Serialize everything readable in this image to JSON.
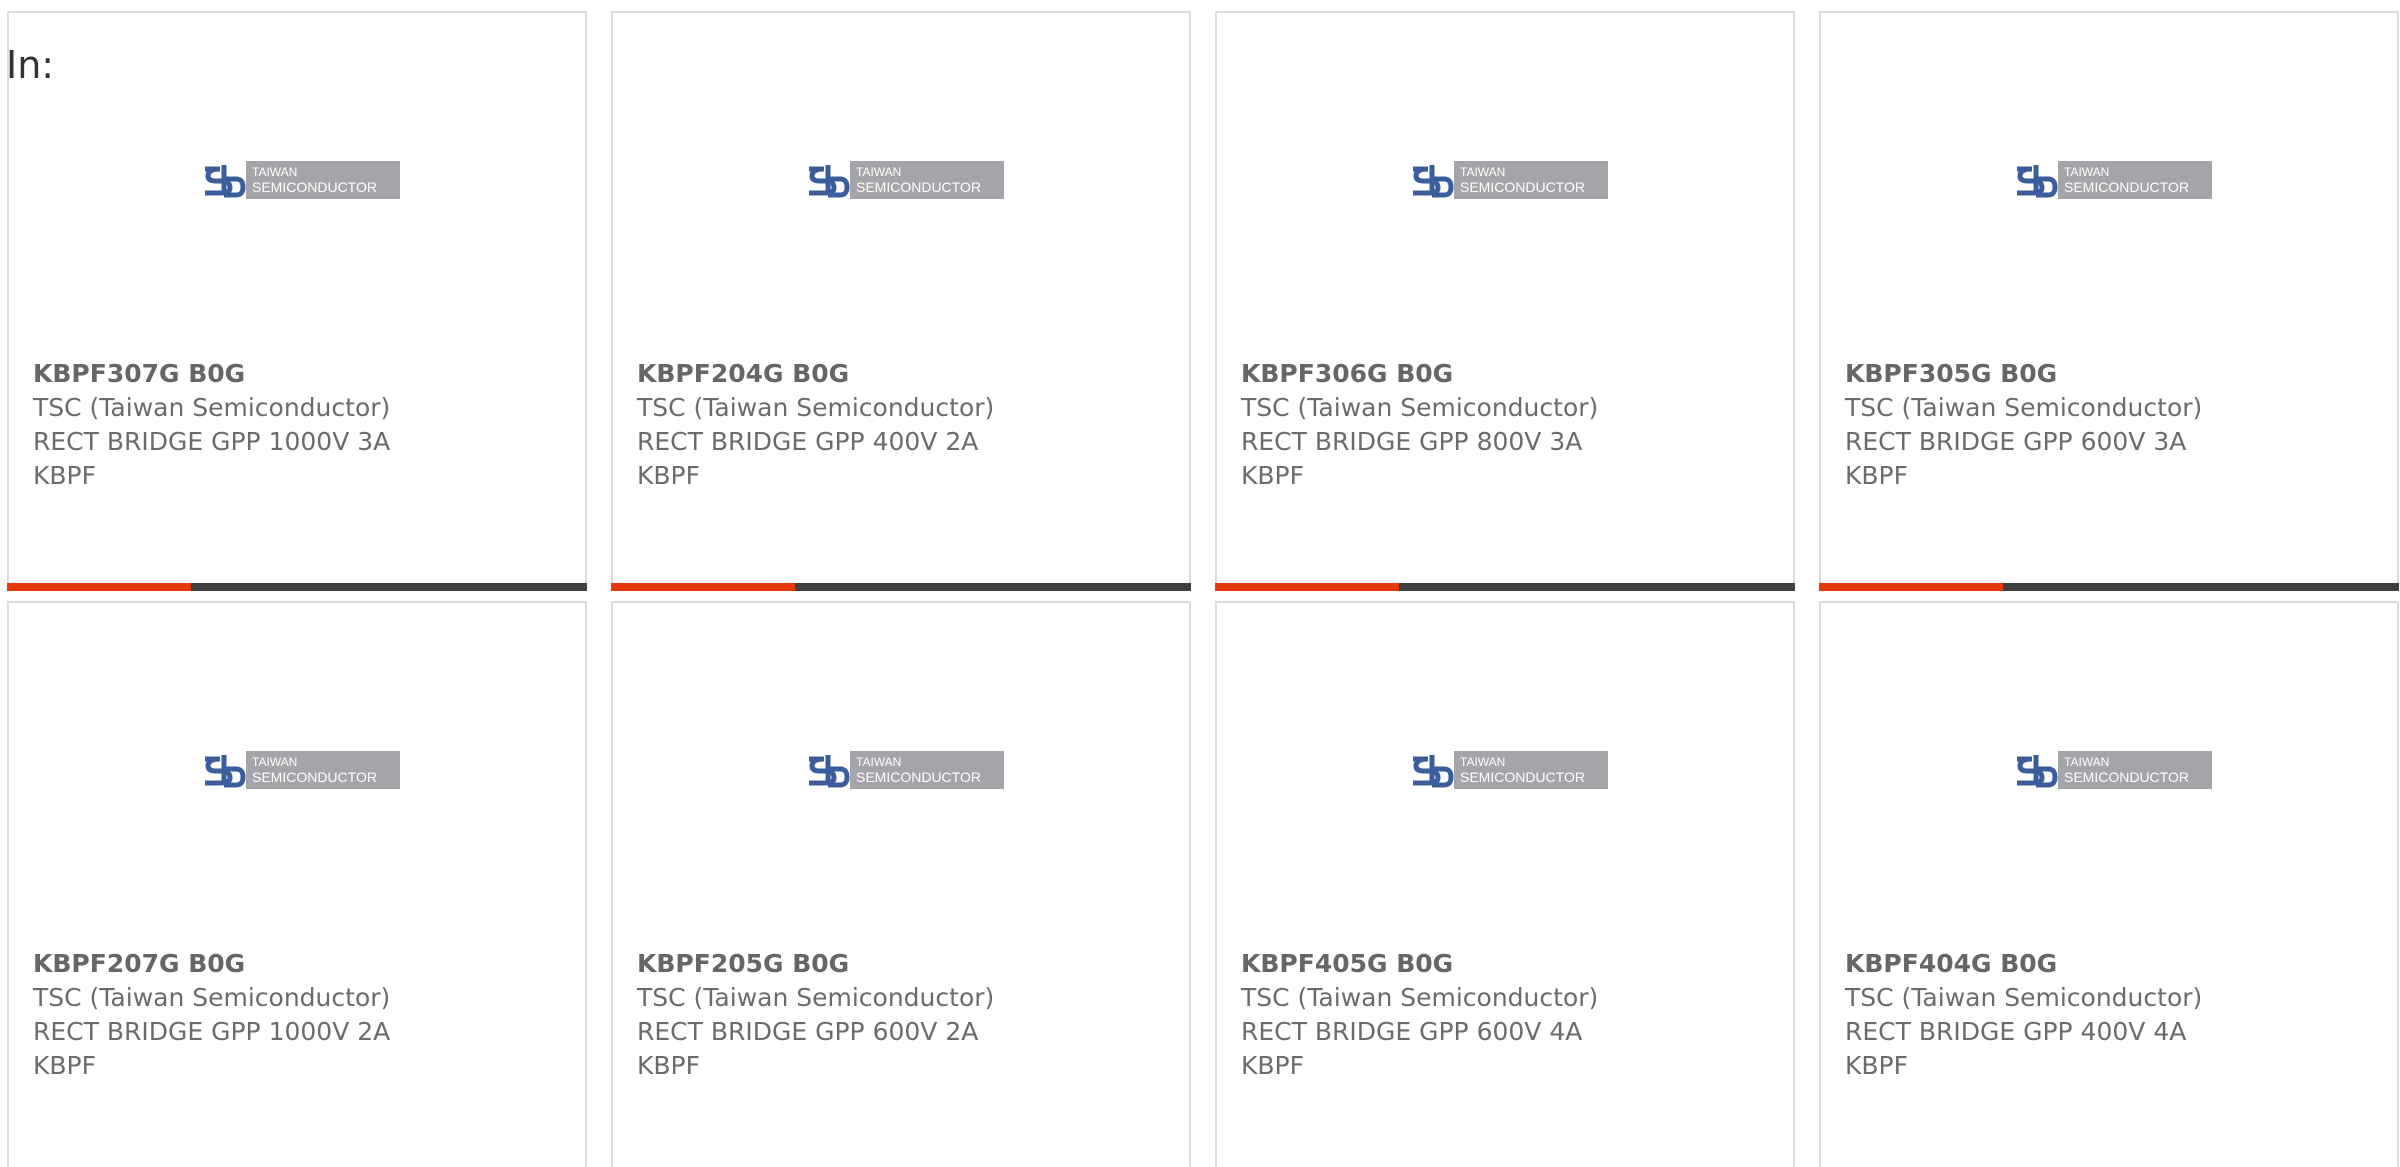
{
  "filter": {
    "label": "In:"
  },
  "colors": {
    "accent": "#e8380d",
    "bar": "#3f3f3f"
  },
  "logo": {
    "icon": "taiwan-semiconductor-logo",
    "line1": "TAIWAN",
    "line2": "SEMICONDUCTOR"
  },
  "products": [
    {
      "part": "KBPF307G B0G",
      "maker": "TSC (Taiwan Semiconductor)",
      "desc_line1": "RECT BRIDGE GPP 1000V 3A",
      "desc_line2": "KBPF"
    },
    {
      "part": "KBPF204G B0G",
      "maker": "TSC (Taiwan Semiconductor)",
      "desc_line1": "RECT BRIDGE GPP 400V 2A KBPF",
      "desc_line2": ""
    },
    {
      "part": "KBPF306G B0G",
      "maker": "TSC (Taiwan Semiconductor)",
      "desc_line1": "RECT BRIDGE GPP 800V 3A KBPF",
      "desc_line2": ""
    },
    {
      "part": "KBPF305G B0G",
      "maker": "TSC (Taiwan Semiconductor)",
      "desc_line1": "RECT BRIDGE GPP 600V 3A KBPF",
      "desc_line2": ""
    },
    {
      "part": "KBPF207G B0G",
      "maker": "TSC (Taiwan Semiconductor)",
      "desc_line1": "RECT BRIDGE GPP 1000V 2A",
      "desc_line2": "KBPF"
    },
    {
      "part": "KBPF205G B0G",
      "maker": "TSC (Taiwan Semiconductor)",
      "desc_line1": "RECT BRIDGE GPP 600V 2A KBPF",
      "desc_line2": ""
    },
    {
      "part": "KBPF405G B0G",
      "maker": "TSC (Taiwan Semiconductor)",
      "desc_line1": "RECT BRIDGE GPP 600V 4A KBPF",
      "desc_line2": ""
    },
    {
      "part": "KBPF404G B0G",
      "maker": "TSC (Taiwan Semiconductor)",
      "desc_line1": "RECT BRIDGE GPP 400V 4A KBPF",
      "desc_line2": ""
    }
  ]
}
